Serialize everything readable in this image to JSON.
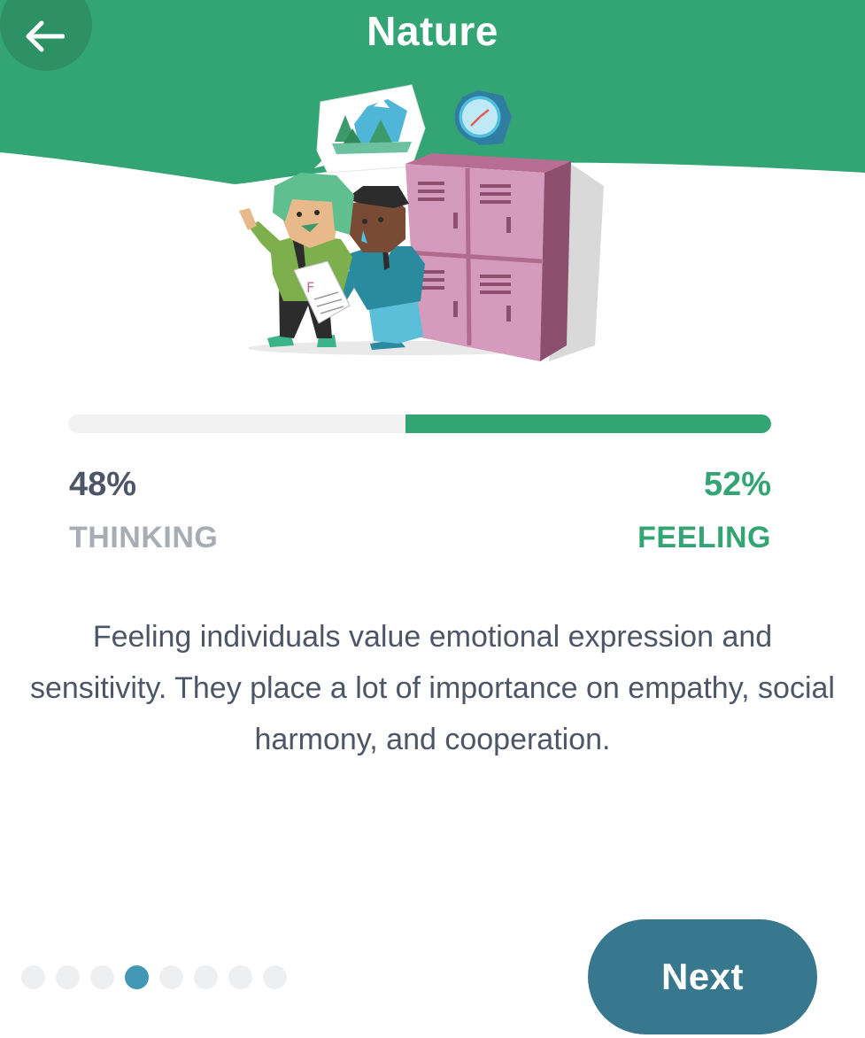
{
  "header": {
    "title": "Nature",
    "back_icon": "arrow-left-icon",
    "background_color": "#33a474"
  },
  "illustration": {
    "description_icon": "students-lockers-illustration"
  },
  "trait": {
    "left": {
      "percent": "48%",
      "label": "THINKING",
      "value": 48
    },
    "right": {
      "percent": "52%",
      "label": "FEELING",
      "value": 52
    },
    "accent_color": "#33a474"
  },
  "description": "Feeling individuals value emotional expression and sensitivity. They place a lot of importance on empathy, social harmony, and cooperation.",
  "pager": {
    "total": 8,
    "active_index": 3
  },
  "next_button": {
    "label": "Next",
    "color": "#38788f"
  }
}
